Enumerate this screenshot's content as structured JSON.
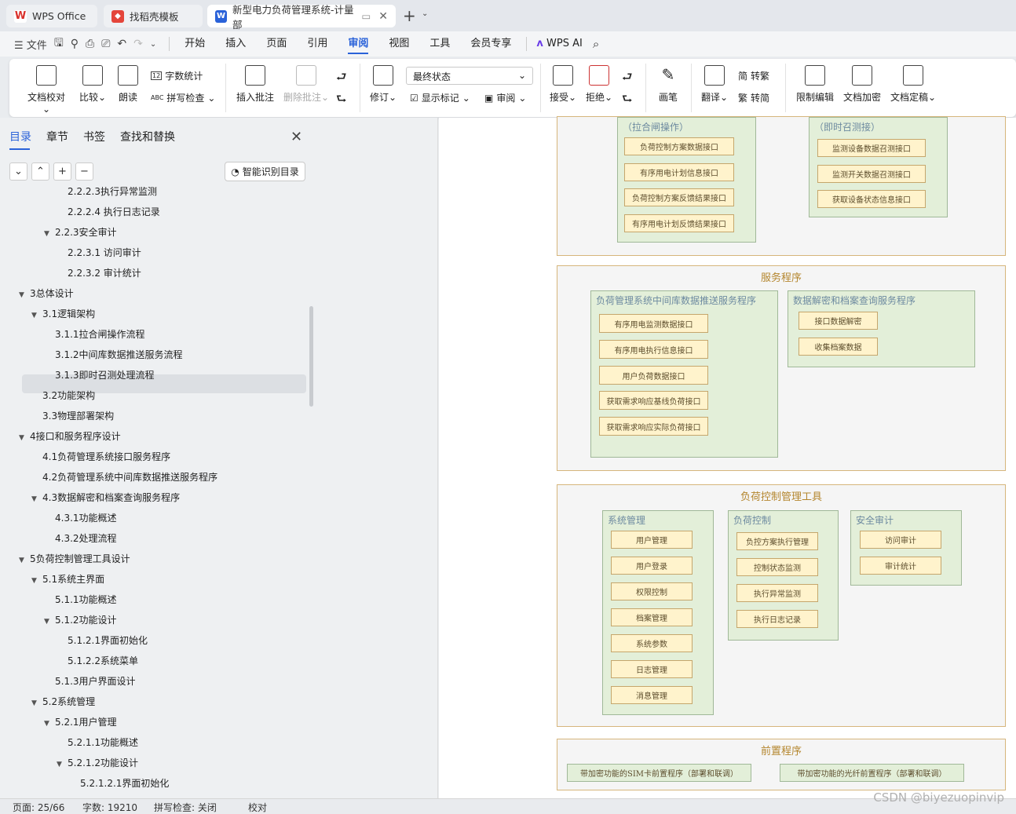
{
  "tabs": [
    {
      "label": "WPS Office",
      "color": "#d9302b"
    },
    {
      "label": "找稻壳模板",
      "color": "#e4453a"
    },
    {
      "label": "新型电力负荷管理系统-计量部",
      "color": "#2a62d9"
    }
  ],
  "menu": {
    "file": "文件",
    "items": [
      "开始",
      "插入",
      "页面",
      "引用",
      "审阅",
      "视图",
      "工具",
      "会员专享"
    ],
    "active": "审阅",
    "ai": "WPS AI"
  },
  "ribbon": {
    "doc_check": "文档校对",
    "compare": "比较",
    "read": "朗读",
    "word_count": "字数统计",
    "spell_check": "拼写检查",
    "insert_comment": "插入批注",
    "delete_comment": "删除批注",
    "track": "修订",
    "state": "最终状态",
    "show_marks": "显示标记",
    "review": "审阅",
    "accept": "接受",
    "reject": "拒绝",
    "pen": "画笔",
    "translate": "翻译",
    "to_trad": "转繁",
    "to_simp": "转简",
    "restrict": "限制编辑",
    "encrypt": "文档加密",
    "finalize": "文档定稿"
  },
  "sidebar": {
    "tabs": [
      "目录",
      "章节",
      "书签",
      "查找和替换"
    ],
    "smart": "智能识别目录",
    "toc": [
      {
        "t": "2.2.2.3执行异常监测",
        "lv": 4
      },
      {
        "t": "2.2.2.4  执行日志记录",
        "lv": 4
      },
      {
        "t": "2.2.3安全审计",
        "lv": 3,
        "a": true
      },
      {
        "t": "2.2.3.1  访问审计",
        "lv": 4
      },
      {
        "t": "2.2.3.2  审计统计",
        "lv": 4
      },
      {
        "t": "3总体设计",
        "lv": 1,
        "a": true
      },
      {
        "t": "3.1逻辑架构",
        "lv": 2,
        "a": true
      },
      {
        "t": "3.1.1拉合闸操作流程",
        "lv": 3
      },
      {
        "t": "3.1.2中间库数据推送服务流程",
        "lv": 3
      },
      {
        "t": "3.1.3即时召测处理流程",
        "lv": 3
      },
      {
        "t": "3.2功能架构",
        "lv": 2
      },
      {
        "t": "3.3物理部署架构",
        "lv": 2
      },
      {
        "t": "4接口和服务程序设计",
        "lv": 1,
        "a": true
      },
      {
        "t": "4.1负荷管理系统接口服务程序",
        "lv": 2
      },
      {
        "t": "4.2负荷管理系统中间库数据推送服务程序",
        "lv": 2
      },
      {
        "t": "4.3数据解密和档案查询服务程序",
        "lv": 2,
        "a": true
      },
      {
        "t": "4.3.1功能概述",
        "lv": 3
      },
      {
        "t": "4.3.2处理流程",
        "lv": 3
      },
      {
        "t": "5负荷控制管理工具设计",
        "lv": 1,
        "a": true
      },
      {
        "t": "5.1系统主界面",
        "lv": 2,
        "a": true
      },
      {
        "t": "5.1.1功能概述",
        "lv": 3
      },
      {
        "t": "5.1.2功能设计",
        "lv": 3,
        "a": true
      },
      {
        "t": "5.1.2.1界面初始化",
        "lv": 4
      },
      {
        "t": "5.1.2.2系统菜单",
        "lv": 4
      },
      {
        "t": "5.1.3用户界面设计",
        "lv": 3
      },
      {
        "t": "5.2系统管理",
        "lv": 2,
        "a": true
      },
      {
        "t": "5.2.1用户管理",
        "lv": 3,
        "a": true
      },
      {
        "t": "5.2.1.1功能概述",
        "lv": 4
      },
      {
        "t": "5.2.1.2功能设计",
        "lv": 4,
        "a": true
      },
      {
        "t": "5.2.1.2.1界面初始化",
        "lv": 5
      }
    ]
  },
  "diagram": {
    "top_left": {
      "title": "（拉合闸操作）",
      "items": [
        "负荷控制方案数据接口",
        "有序用电计划信息接口",
        "负荷控制方案反馈结果接口",
        "有序用电计划反馈结果接口"
      ]
    },
    "top_right": {
      "title": "（即时召测接）",
      "items": [
        "监测设备数据召测接口",
        "监测开关数据召测接口",
        "获取设备状态信息接口"
      ]
    },
    "services": {
      "title": "服务程序",
      "g1": {
        "title": "负荷管理系统中间库数据推送服务程序",
        "items": [
          "有序用电监测数据接口",
          "有序用电执行信息接口",
          "用户负荷数据接口",
          "获取需求响应基线负荷接口",
          "获取需求响应实际负荷接口"
        ]
      },
      "g2": {
        "title": "数据解密和档案查询服务程序",
        "items": [
          "接口数据解密",
          "收集档案数据"
        ]
      }
    },
    "tools": {
      "title": "负荷控制管理工具",
      "g1": {
        "title": "系统管理",
        "items": [
          "用户管理",
          "用户登录",
          "权限控制",
          "档案管理",
          "系统参数",
          "日志管理",
          "消息管理"
        ]
      },
      "g2": {
        "title": "负荷控制",
        "items": [
          "负控方案执行管理",
          "控制状态监测",
          "执行异常监测",
          "执行日志记录"
        ]
      },
      "g3": {
        "title": "安全审计",
        "items": [
          "访问审计",
          "审计统计"
        ]
      }
    },
    "front": {
      "title": "前置程序",
      "items": [
        "带加密功能的SIM卡前置程序（部署和联调）",
        "带加密功能的光纤前置程序（部署和联调）"
      ]
    }
  },
  "status": {
    "page": "页面: 25/66",
    "words": "字数: 19210",
    "spell": "拼写检查: 关闭",
    "proof": "校对"
  },
  "watermark": "CSDN @biyezuopinvip"
}
